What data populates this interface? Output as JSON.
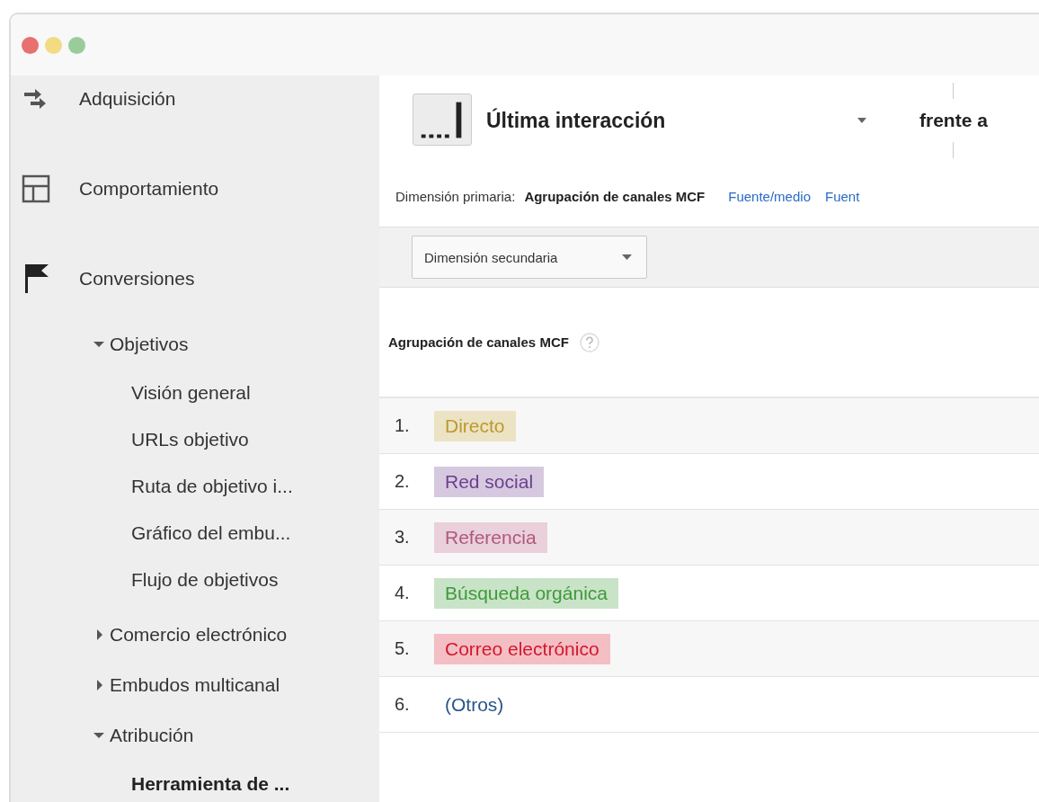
{
  "sidebar": {
    "items": [
      {
        "label": "Adquisición",
        "kind": "arrows"
      },
      {
        "label": "Comportamiento",
        "kind": "layout"
      },
      {
        "label": "Conversiones",
        "kind": "flag",
        "children": [
          {
            "label": "Objetivos",
            "expanded": true,
            "children": [
              {
                "label": "Visión general",
                "selected": false
              },
              {
                "label": "URLs objetivo",
                "selected": false
              },
              {
                "label": "Ruta de objetivo i...",
                "selected": false
              },
              {
                "label": "Gráfico del embu...",
                "selected": false
              },
              {
                "label": "Flujo de objetivos",
                "selected": false
              }
            ]
          },
          {
            "label": "Comercio electrónico",
            "expanded": false
          },
          {
            "label": "Embudos multicanal",
            "expanded": false
          },
          {
            "label": "Atribución",
            "expanded": true,
            "children": [
              {
                "label": "Herramienta de ...",
                "selected": true
              }
            ]
          }
        ]
      }
    ]
  },
  "model": {
    "title": "Última interacción",
    "versus": "frente a"
  },
  "primary_dimension": {
    "label": "Dimensión primaria:",
    "options": [
      {
        "label": "Agrupación de canales MCF",
        "selected": true
      },
      {
        "label": "Fuente/medio",
        "selected": false
      },
      {
        "label": "Fuent",
        "selected": false
      }
    ]
  },
  "secondary_dimension": {
    "label": "Dimensión secundaria"
  },
  "table": {
    "columns": [
      "Agrupación de canales MCF"
    ],
    "rows": [
      {
        "index": "1.",
        "channel": "Directo",
        "color": "#bb9a2c",
        "highlight": true
      },
      {
        "index": "2.",
        "channel": "Red social",
        "color": "#6b3f8e",
        "highlight": true
      },
      {
        "index": "3.",
        "channel": "Referencia",
        "color": "#b0587c",
        "highlight": true
      },
      {
        "index": "4.",
        "channel": "Búsqueda orgánica",
        "color": "#3f9a3a",
        "highlight": true
      },
      {
        "index": "5.",
        "channel": "Correo electrónico",
        "color": "#d3172c",
        "highlight": true
      },
      {
        "index": "6.",
        "channel": "(Otros)",
        "color": "#2b5589",
        "highlight": false
      }
    ]
  }
}
